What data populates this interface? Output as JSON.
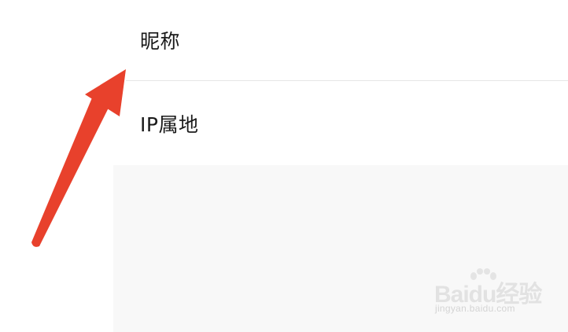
{
  "settings": {
    "items": [
      {
        "label": "昵称"
      },
      {
        "label": "IP属地"
      }
    ]
  },
  "watermark": {
    "brand": "Baidu经验",
    "url": "jingyan.baidu.com"
  },
  "annotation": {
    "arrow_color": "#e8412c",
    "points_to": "昵称"
  },
  "colors": {
    "background": "#ffffff",
    "empty_area": "#f8f8f8",
    "divider": "#e6e6e6",
    "text": "#1a1a1a"
  }
}
